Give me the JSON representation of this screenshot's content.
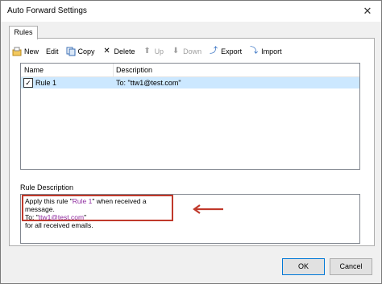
{
  "window": {
    "title": "Auto Forward Settings"
  },
  "tabs": [
    {
      "label": "Rules"
    }
  ],
  "toolbar": {
    "new_label": "New",
    "edit_label": "Edit",
    "copy_label": "Copy",
    "delete_label": "Delete",
    "up_label": "Up",
    "down_label": "Down",
    "export_label": "Export",
    "import_label": "Import"
  },
  "rules_list": {
    "columns": [
      "Name",
      "Description"
    ],
    "rows": [
      {
        "checked": true,
        "name": "Rule 1",
        "description": "To: \"ttw1@test.com\""
      }
    ]
  },
  "rule_description": {
    "label": "Rule Description",
    "line1_pre": "Apply this rule \"",
    "line1_rule": "Rule 1",
    "line1_post": "\" when received a message.",
    "line2_pre": "To: \"",
    "line2_email": "ttw1@test.com",
    "line2_post": "\"",
    "line3": "for all received emails."
  },
  "footer": {
    "ok_label": "OK",
    "cancel_label": "Cancel"
  },
  "colors": {
    "selection": "#cce8ff",
    "highlight_border": "#c0392b",
    "link_purple": "#8e2ca0"
  }
}
